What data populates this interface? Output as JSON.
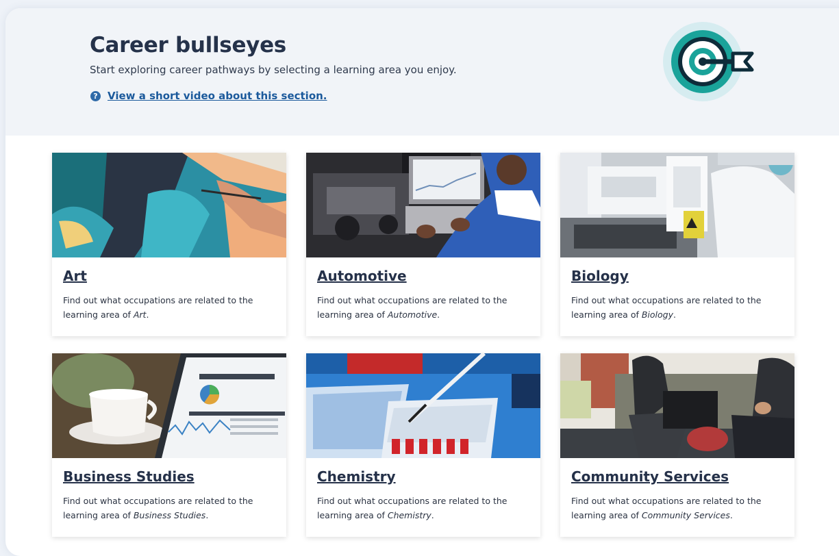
{
  "header": {
    "title": "Career bullseyes",
    "subtitle": "Start exploring career pathways by selecting a learning area you enjoy.",
    "help_link": "View a short video about this section.",
    "help_icon": "question-circle-icon",
    "logo_icon": "bullseye-target-icon"
  },
  "desc_prefix": "Find out what occupations are related to the learning area of ",
  "desc_suffix": ".",
  "cards": [
    {
      "title": "Art",
      "area": "Art",
      "image": "painting-photo"
    },
    {
      "title": "Automotive",
      "area": "Automotive",
      "image": "mechanic-laptop-photo"
    },
    {
      "title": "Biology",
      "area": "Biology",
      "image": "laboratory-photo"
    },
    {
      "title": "Business Studies",
      "area": "Business Studies",
      "image": "analytics-tablet-photo"
    },
    {
      "title": "Chemistry",
      "area": "Chemistry",
      "image": "pipette-tray-photo"
    },
    {
      "title": "Community Services",
      "area": "Community Services",
      "image": "people-sofa-photo"
    }
  ],
  "colors": {
    "accent": "#1aa39a",
    "link": "#1c5a9c",
    "title": "#25324a"
  }
}
